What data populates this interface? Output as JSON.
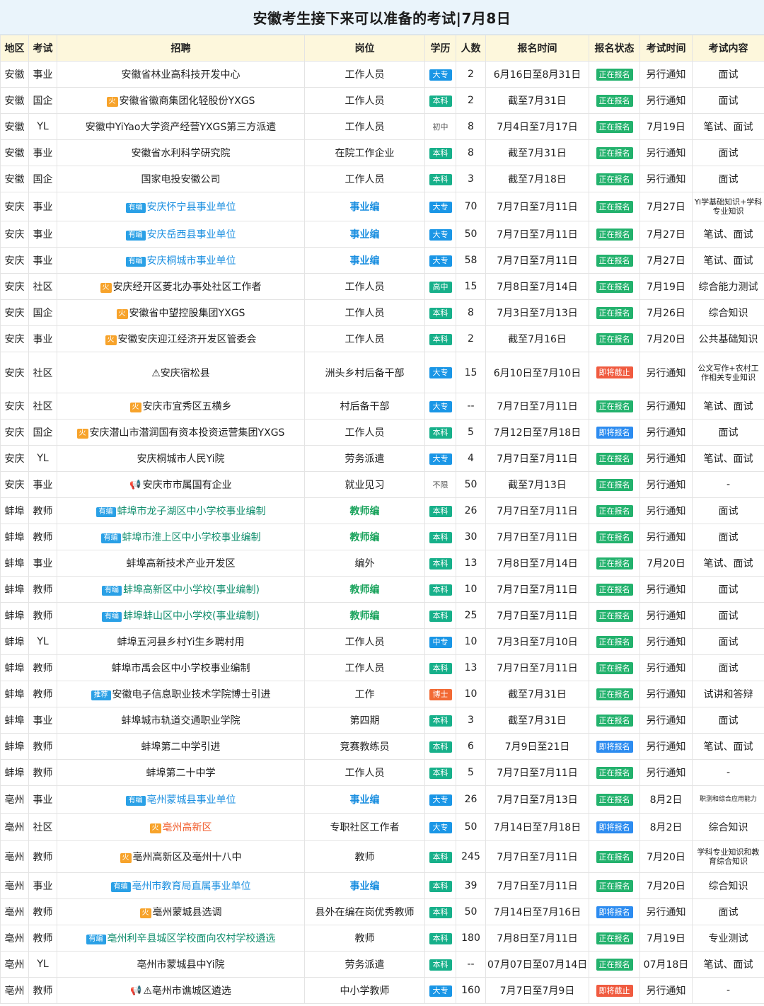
{
  "title": "安徽考生接下来可以准备的考试|7月8日",
  "colors": {
    "header_bg": "#fdf7dc",
    "title_bg": "#eaf4fb",
    "edu_blue": "#1a96e6",
    "edu_teal": "#17b08a",
    "edu_orange": "#f26a34",
    "status_green": "#23b26d",
    "status_blue": "#2d8cf0",
    "status_red": "#f05b40"
  },
  "columns": [
    "地区",
    "考试",
    "招聘",
    "岗位",
    "学历",
    "人数",
    "报名时间",
    "报名状态",
    "考试时间",
    "考试内容"
  ],
  "rows": [
    {
      "region": "安徽",
      "type": "事业",
      "recruit": "安徽省林业高科技开发中心",
      "tag": "",
      "tag_text": "",
      "link": "",
      "position": "工作人员",
      "pos_style": "",
      "edu": "大专",
      "edu_color": "blue",
      "count": "2",
      "signup": "6月16日至8月31日",
      "status": "正在报名",
      "status_color": "green",
      "exam_time": "另行通知",
      "content": "面试",
      "content_size": ""
    },
    {
      "region": "安徽",
      "type": "国企",
      "recruit": "安徽省徽商集团化轻股份YXGS",
      "tag": "fire",
      "tag_text": "火",
      "link": "",
      "position": "工作人员",
      "pos_style": "",
      "edu": "本科",
      "edu_color": "teal",
      "count": "2",
      "signup": "截至7月31日",
      "status": "正在报名",
      "status_color": "green",
      "exam_time": "另行通知",
      "content": "面试",
      "content_size": ""
    },
    {
      "region": "安徽",
      "type": "YL",
      "recruit": "安徽中YiYao大学资产经营YXGS第三方派遣",
      "tag": "",
      "tag_text": "",
      "link": "",
      "position": "工作人员",
      "pos_style": "",
      "edu": "初中",
      "edu_color": "plain",
      "count": "8",
      "signup": "7月4日至7月17日",
      "status": "正在报名",
      "status_color": "green",
      "exam_time": "7月19日",
      "content": "笔试、面试",
      "content_size": ""
    },
    {
      "region": "安徽",
      "type": "事业",
      "recruit": "安徽省水利科学研究院",
      "tag": "",
      "tag_text": "",
      "link": "",
      "position": "在院工作企业",
      "pos_style": "",
      "edu": "本科",
      "edu_color": "teal",
      "count": "8",
      "signup": "截至7月31日",
      "status": "正在报名",
      "status_color": "green",
      "exam_time": "另行通知",
      "content": "面试",
      "content_size": ""
    },
    {
      "region": "安徽",
      "type": "国企",
      "recruit": "国家电投安徽公司",
      "tag": "",
      "tag_text": "",
      "link": "",
      "position": "工作人员",
      "pos_style": "",
      "edu": "本科",
      "edu_color": "teal",
      "count": "3",
      "signup": "截至7月18日",
      "status": "正在报名",
      "status_color": "green",
      "exam_time": "另行通知",
      "content": "面试",
      "content_size": ""
    },
    {
      "region": "安庆",
      "type": "事业",
      "recruit": "安庆怀宁县事业单位",
      "tag": "bianzhi",
      "tag_text": "有编",
      "link": "blue",
      "position": "事业编",
      "pos_style": "blue",
      "edu": "大专",
      "edu_color": "blue",
      "count": "70",
      "signup": "7月7日至7月11日",
      "status": "正在报名",
      "status_color": "green",
      "exam_time": "7月27日",
      "content": "Yi学基础知识+学科专业知识",
      "content_size": "small"
    },
    {
      "region": "安庆",
      "type": "事业",
      "recruit": "安庆岳西县事业单位",
      "tag": "bianzhi",
      "tag_text": "有编",
      "link": "blue",
      "position": "事业编",
      "pos_style": "blue",
      "edu": "大专",
      "edu_color": "blue",
      "count": "50",
      "signup": "7月7日至7月11日",
      "status": "正在报名",
      "status_color": "green",
      "exam_time": "7月27日",
      "content": "笔试、面试",
      "content_size": ""
    },
    {
      "region": "安庆",
      "type": "事业",
      "recruit": "安庆桐城市事业单位",
      "tag": "bianzhi",
      "tag_text": "有编",
      "link": "blue",
      "position": "事业编",
      "pos_style": "blue",
      "edu": "大专",
      "edu_color": "blue",
      "count": "58",
      "signup": "7月7日至7月11日",
      "status": "正在报名",
      "status_color": "green",
      "exam_time": "7月27日",
      "content": "笔试、面试",
      "content_size": ""
    },
    {
      "region": "安庆",
      "type": "社区",
      "recruit": "安庆经开区菱北办事处社区工作者",
      "tag": "fire",
      "tag_text": "火",
      "link": "",
      "position": "工作人员",
      "pos_style": "",
      "edu": "高中",
      "edu_color": "teal",
      "count": "15",
      "signup": "7月8日至7月14日",
      "status": "正在报名",
      "status_color": "green",
      "exam_time": "7月19日",
      "content": "综合能力测试",
      "content_size": ""
    },
    {
      "region": "安庆",
      "type": "国企",
      "recruit": "安徽省中望控股集团YXGS",
      "tag": "fire",
      "tag_text": "火",
      "link": "",
      "position": "工作人员",
      "pos_style": "",
      "edu": "本科",
      "edu_color": "teal",
      "count": "8",
      "signup": "7月3日至7月13日",
      "status": "正在报名",
      "status_color": "green",
      "exam_time": "7月26日",
      "content": "综合知识",
      "content_size": ""
    },
    {
      "region": "安庆",
      "type": "事业",
      "recruit": "安徽安庆迎江经济开发区管委会",
      "tag": "fire",
      "tag_text": "火",
      "link": "",
      "position": "工作人员",
      "pos_style": "",
      "edu": "本科",
      "edu_color": "teal",
      "count": "2",
      "signup": "截至7月16日",
      "status": "正在报名",
      "status_color": "green",
      "exam_time": "7月20日",
      "content": "公共基础知识",
      "content_size": ""
    },
    {
      "region": "安庆",
      "type": "社区",
      "recruit": "⚠安庆宿松县",
      "tag": "",
      "tag_text": "",
      "link": "",
      "position": "洲头乡村后备干部",
      "pos_style": "",
      "edu": "大专",
      "edu_color": "blue",
      "count": "15",
      "signup": "6月10日至7月10日",
      "status": "即将截止",
      "status_color": "red",
      "exam_time": "另行通知",
      "content": "公文写作+农村工作相关专业知识",
      "content_size": "small"
    },
    {
      "region": "安庆",
      "type": "社区",
      "recruit": "安庆市宜秀区五横乡",
      "tag": "fire",
      "tag_text": "火",
      "link": "",
      "position": "村后备干部",
      "pos_style": "",
      "edu": "大专",
      "edu_color": "blue",
      "count": "--",
      "signup": "7月7日至7月11日",
      "status": "正在报名",
      "status_color": "green",
      "exam_time": "另行通知",
      "content": "笔试、面试",
      "content_size": ""
    },
    {
      "region": "安庆",
      "type": "国企",
      "recruit": "安庆潜山市潜润国有资本投资运营集团YXGS",
      "tag": "fire",
      "tag_text": "火",
      "link": "",
      "position": "工作人员",
      "pos_style": "",
      "edu": "本科",
      "edu_color": "teal",
      "count": "5",
      "signup": "7月12日至7月18日",
      "status": "即将报名",
      "status_color": "blue",
      "exam_time": "另行通知",
      "content": "面试",
      "content_size": ""
    },
    {
      "region": "安庆",
      "type": "YL",
      "recruit": "安庆桐城市人民Yi院",
      "tag": "",
      "tag_text": "",
      "link": "",
      "position": "劳务派遣",
      "pos_style": "",
      "edu": "大专",
      "edu_color": "blue",
      "count": "4",
      "signup": "7月7日至7月11日",
      "status": "正在报名",
      "status_color": "green",
      "exam_time": "另行通知",
      "content": "笔试、面试",
      "content_size": ""
    },
    {
      "region": "安庆",
      "type": "事业",
      "recruit": "安庆市市属国有企业",
      "tag": "speaker",
      "tag_text": "📢",
      "link": "",
      "position": "就业见习",
      "pos_style": "",
      "edu": "不限",
      "edu_color": "plain",
      "count": "50",
      "signup": "截至7月13日",
      "status": "正在报名",
      "status_color": "green",
      "exam_time": "另行通知",
      "content": "-",
      "content_size": ""
    },
    {
      "region": "蚌埠",
      "type": "教师",
      "recruit": "蚌埠市龙子湖区中小学校事业编制",
      "tag": "bianzhi",
      "tag_text": "有编",
      "link": "teal",
      "position": "教师编",
      "pos_style": "green",
      "edu": "本科",
      "edu_color": "teal",
      "count": "26",
      "signup": "7月7日至7月11日",
      "status": "正在报名",
      "status_color": "green",
      "exam_time": "另行通知",
      "content": "面试",
      "content_size": ""
    },
    {
      "region": "蚌埠",
      "type": "教师",
      "recruit": "蚌埠市淮上区中小学校事业编制",
      "tag": "bianzhi",
      "tag_text": "有编",
      "link": "teal",
      "position": "教师编",
      "pos_style": "green",
      "edu": "本科",
      "edu_color": "teal",
      "count": "30",
      "signup": "7月7日至7月11日",
      "status": "正在报名",
      "status_color": "green",
      "exam_time": "另行通知",
      "content": "面试",
      "content_size": ""
    },
    {
      "region": "蚌埠",
      "type": "事业",
      "recruit": "蚌埠高新技术产业开发区",
      "tag": "",
      "tag_text": "",
      "link": "",
      "position": "编外",
      "pos_style": "",
      "edu": "本科",
      "edu_color": "teal",
      "count": "13",
      "signup": "7月8日至7月14日",
      "status": "正在报名",
      "status_color": "green",
      "exam_time": "7月20日",
      "content": "笔试、面试",
      "content_size": ""
    },
    {
      "region": "蚌埠",
      "type": "教师",
      "recruit": "蚌埠高新区中小学校(事业编制)",
      "tag": "bianzhi",
      "tag_text": "有编",
      "link": "teal",
      "position": "教师编",
      "pos_style": "green",
      "edu": "本科",
      "edu_color": "teal",
      "count": "10",
      "signup": "7月7日至7月11日",
      "status": "正在报名",
      "status_color": "green",
      "exam_time": "另行通知",
      "content": "面试",
      "content_size": ""
    },
    {
      "region": "蚌埠",
      "type": "教师",
      "recruit": "蚌埠蚌山区中小学校(事业编制)",
      "tag": "bianzhi",
      "tag_text": "有编",
      "link": "teal",
      "position": "教师编",
      "pos_style": "green",
      "edu": "本科",
      "edu_color": "teal",
      "count": "25",
      "signup": "7月7日至7月11日",
      "status": "正在报名",
      "status_color": "green",
      "exam_time": "另行通知",
      "content": "面试",
      "content_size": ""
    },
    {
      "region": "蚌埠",
      "type": "YL",
      "recruit": "蚌埠五河县乡村Yi生乡聘村用",
      "tag": "",
      "tag_text": "",
      "link": "",
      "position": "工作人员",
      "pos_style": "",
      "edu": "中专",
      "edu_color": "blue",
      "count": "10",
      "signup": "7月3日至7月10日",
      "status": "正在报名",
      "status_color": "green",
      "exam_time": "另行通知",
      "content": "面试",
      "content_size": ""
    },
    {
      "region": "蚌埠",
      "type": "教师",
      "recruit": "蚌埠市禹会区中小学校事业编制",
      "tag": "",
      "tag_text": "",
      "link": "",
      "position": "工作人员",
      "pos_style": "",
      "edu": "本科",
      "edu_color": "teal",
      "count": "13",
      "signup": "7月7日至7月11日",
      "status": "正在报名",
      "status_color": "green",
      "exam_time": "另行通知",
      "content": "面试",
      "content_size": ""
    },
    {
      "region": "蚌埠",
      "type": "教师",
      "recruit": "安徽电子信息职业技术学院博士引进",
      "tag": "tuijian",
      "tag_text": "推荐",
      "link": "",
      "position": "工作",
      "pos_style": "",
      "edu": "博士",
      "edu_color": "orange",
      "count": "10",
      "signup": "截至7月31日",
      "status": "正在报名",
      "status_color": "green",
      "exam_time": "另行通知",
      "content": "试讲和答辩",
      "content_size": ""
    },
    {
      "region": "蚌埠",
      "type": "事业",
      "recruit": "蚌埠城市轨道交通职业学院",
      "tag": "",
      "tag_text": "",
      "link": "",
      "position": "第四期",
      "pos_style": "",
      "edu": "本科",
      "edu_color": "teal",
      "count": "3",
      "signup": "截至7月31日",
      "status": "正在报名",
      "status_color": "green",
      "exam_time": "另行通知",
      "content": "面试",
      "content_size": ""
    },
    {
      "region": "蚌埠",
      "type": "教师",
      "recruit": "蚌埠第二中学引进",
      "tag": "",
      "tag_text": "",
      "link": "",
      "position": "竞赛教练员",
      "pos_style": "",
      "edu": "本科",
      "edu_color": "teal",
      "count": "6",
      "signup": "7月9日至21日",
      "status": "即将报名",
      "status_color": "blue",
      "exam_time": "另行通知",
      "content": "笔试、面试",
      "content_size": ""
    },
    {
      "region": "蚌埠",
      "type": "教师",
      "recruit": "蚌埠第二十中学",
      "tag": "",
      "tag_text": "",
      "link": "",
      "position": "工作人员",
      "pos_style": "",
      "edu": "本科",
      "edu_color": "teal",
      "count": "5",
      "signup": "7月7日至7月11日",
      "status": "正在报名",
      "status_color": "green",
      "exam_time": "另行通知",
      "content": "-",
      "content_size": ""
    },
    {
      "region": "亳州",
      "type": "事业",
      "recruit": "亳州蒙城县事业单位",
      "tag": "bianzhi",
      "tag_text": "有编",
      "link": "blue",
      "position": "事业编",
      "pos_style": "blue",
      "edu": "大专",
      "edu_color": "blue",
      "count": "26",
      "signup": "7月7日至7月13日",
      "status": "正在报名",
      "status_color": "green",
      "exam_time": "8月2日",
      "content": "职测和综合应用能力",
      "content_size": "tiny"
    },
    {
      "region": "亳州",
      "type": "社区",
      "recruit": "亳州高新区",
      "tag": "fire",
      "tag_text": "火",
      "link": "orange",
      "position": "专职社区工作者",
      "pos_style": "",
      "edu": "大专",
      "edu_color": "blue",
      "count": "50",
      "signup": "7月14日至7月18日",
      "status": "即将报名",
      "status_color": "blue",
      "exam_time": "8月2日",
      "content": "综合知识",
      "content_size": ""
    },
    {
      "region": "亳州",
      "type": "教师",
      "recruit": "亳州高新区及亳州十八中",
      "tag": "fire",
      "tag_text": "火",
      "link": "",
      "position": "教师",
      "pos_style": "",
      "edu": "本科",
      "edu_color": "teal",
      "count": "245",
      "signup": "7月7日至7月11日",
      "status": "正在报名",
      "status_color": "green",
      "exam_time": "7月20日",
      "content": "学科专业知识和教育综合知识",
      "content_size": "small"
    },
    {
      "region": "亳州",
      "type": "事业",
      "recruit": "亳州市教育局直属事业单位",
      "tag": "bianzhi",
      "tag_text": "有编",
      "link": "blue",
      "position": "事业编",
      "pos_style": "blue",
      "edu": "本科",
      "edu_color": "teal",
      "count": "39",
      "signup": "7月7日至7月11日",
      "status": "正在报名",
      "status_color": "green",
      "exam_time": "7月20日",
      "content": "综合知识",
      "content_size": ""
    },
    {
      "region": "亳州",
      "type": "教师",
      "recruit": "亳州蒙城县选调",
      "tag": "fire",
      "tag_text": "火",
      "link": "",
      "position": "县外在编在岗优秀教师",
      "pos_style": "",
      "edu": "本科",
      "edu_color": "teal",
      "count": "50",
      "signup": "7月14日至7月16日",
      "status": "即将报名",
      "status_color": "blue",
      "exam_time": "另行通知",
      "content": "面试",
      "content_size": ""
    },
    {
      "region": "亳州",
      "type": "教师",
      "recruit": "亳州利辛县城区学校面向农村学校遴选",
      "tag": "bianzhi",
      "tag_text": "有编",
      "link": "teal",
      "position": "教师",
      "pos_style": "",
      "edu": "本科",
      "edu_color": "teal",
      "count": "180",
      "signup": "7月8日至7月11日",
      "status": "正在报名",
      "status_color": "green",
      "exam_time": "7月19日",
      "content": "专业测试",
      "content_size": ""
    },
    {
      "region": "亳州",
      "type": "YL",
      "recruit": "亳州市蒙城县中Yi院",
      "tag": "",
      "tag_text": "",
      "link": "",
      "position": "劳务派遣",
      "pos_style": "",
      "edu": "本科",
      "edu_color": "teal",
      "count": "--",
      "signup": "07月07日至07月14日",
      "status": "正在报名",
      "status_color": "green",
      "exam_time": "07月18日",
      "content": "笔试、面试",
      "content_size": ""
    },
    {
      "region": "亳州",
      "type": "教师",
      "recruit": "⚠亳州市谯城区遴选",
      "tag": "speaker",
      "tag_text": "📢",
      "link": "",
      "position": "中小学教师",
      "pos_style": "",
      "edu": "大专",
      "edu_color": "blue",
      "count": "160",
      "signup": "7月7日至7月9日",
      "status": "即将截止",
      "status_color": "red",
      "exam_time": "另行通知",
      "content": "-",
      "content_size": ""
    }
  ]
}
